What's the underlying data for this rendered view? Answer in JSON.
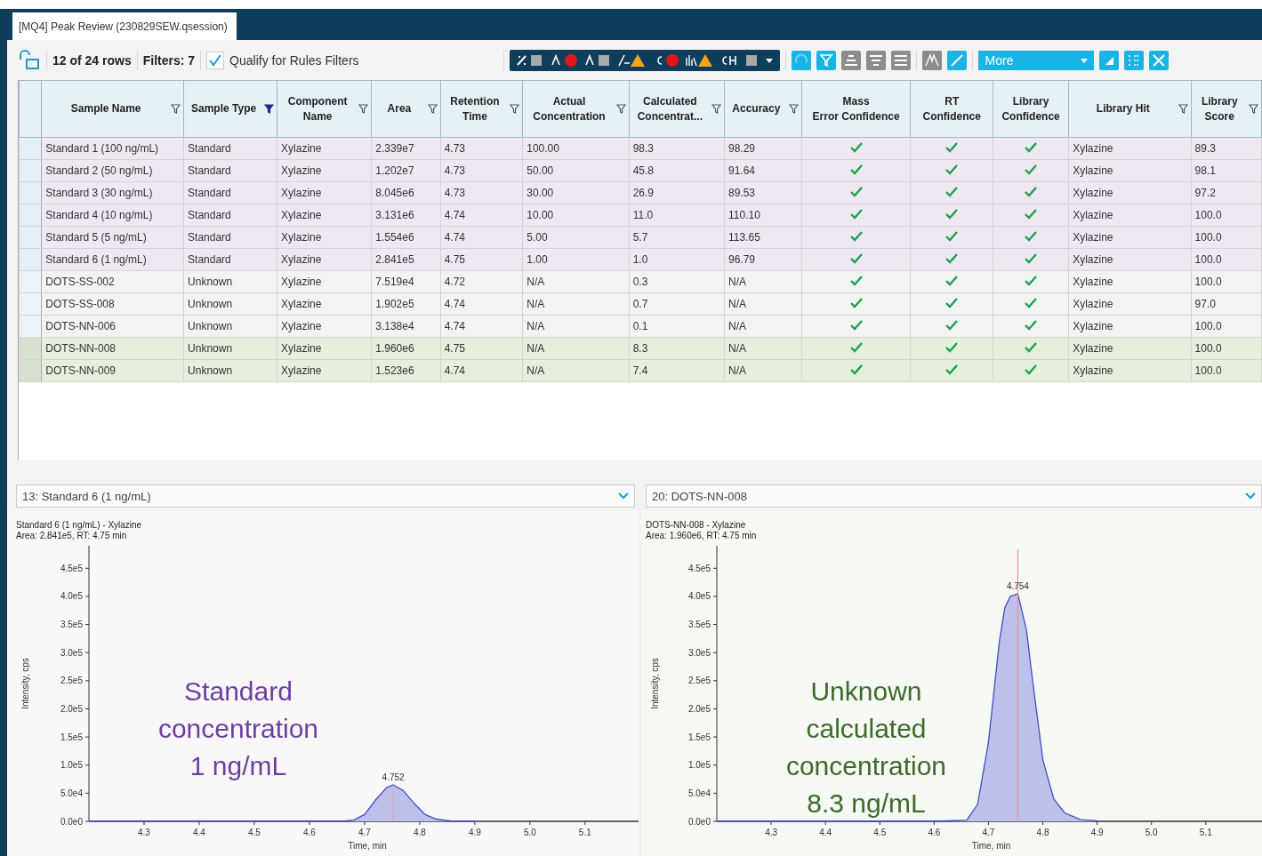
{
  "window": {
    "tab": "[MQ4] Peak Review (230829SEW.qsession)"
  },
  "toolbar": {
    "row_count": "12 of 24 rows",
    "filters": "Filters: 7",
    "qualify": {
      "label": "Qualify for Rules Filters",
      "checked": true
    },
    "more": "More"
  },
  "table": {
    "columns": [
      {
        "label": "Sample Name",
        "filterable": true,
        "filter_active": false
      },
      {
        "label": "Sample Type",
        "filterable": true,
        "filter_active": true
      },
      {
        "label": "Component\nName",
        "filterable": true,
        "filter_active": false
      },
      {
        "label": "Area",
        "filterable": true,
        "filter_active": false
      },
      {
        "label": "Retention\nTime",
        "filterable": true,
        "filter_active": false
      },
      {
        "label": "Actual\nConcentration",
        "filterable": true,
        "filter_active": false
      },
      {
        "label": "Calculated\nConcentrat...",
        "filterable": true,
        "filter_active": false
      },
      {
        "label": "Accuracy",
        "filterable": true,
        "filter_active": false
      },
      {
        "label": "Mass\nError Confidence",
        "filterable": false
      },
      {
        "label": "RT\nConfidence",
        "filterable": false
      },
      {
        "label": "Library\nConfidence",
        "filterable": false
      },
      {
        "label": "Library Hit",
        "filterable": true,
        "filter_active": false
      },
      {
        "label": "Library\nScore",
        "filterable": true,
        "filter_active": false
      }
    ],
    "rows": [
      {
        "kind": "standard",
        "selected": false,
        "cells": [
          "Standard 1 (100 ng/mL)",
          "Standard",
          "Xylazine",
          "2.339e7",
          "4.73",
          "100.00",
          "98.3",
          "98.29",
          true,
          true,
          true,
          "Xylazine",
          "89.3"
        ]
      },
      {
        "kind": "standard",
        "selected": false,
        "cells": [
          "Standard 2 (50 ng/mL)",
          "Standard",
          "Xylazine",
          "1.202e7",
          "4.73",
          "50.00",
          "45.8",
          "91.64",
          true,
          true,
          true,
          "Xylazine",
          "98.1"
        ]
      },
      {
        "kind": "standard",
        "selected": false,
        "cells": [
          "Standard 3 (30 ng/mL)",
          "Standard",
          "Xylazine",
          "8.045e6",
          "4.73",
          "30.00",
          "26.9",
          "89.53",
          true,
          true,
          true,
          "Xylazine",
          "97.2"
        ]
      },
      {
        "kind": "standard",
        "selected": false,
        "cells": [
          "Standard 4 (10 ng/mL)",
          "Standard",
          "Xylazine",
          "3.131e6",
          "4.74",
          "10.00",
          "11.0",
          "110.10",
          true,
          true,
          true,
          "Xylazine",
          "100.0"
        ]
      },
      {
        "kind": "standard",
        "selected": false,
        "cells": [
          "Standard 5 (5 ng/mL)",
          "Standard",
          "Xylazine",
          "1.554e6",
          "4.74",
          "5.00",
          "5.7",
          "113.65",
          true,
          true,
          true,
          "Xylazine",
          "100.0"
        ]
      },
      {
        "kind": "standard",
        "selected": false,
        "cells": [
          "Standard 6 (1 ng/mL)",
          "Standard",
          "Xylazine",
          "2.841e5",
          "4.75",
          "1.00",
          "1.0",
          "96.79",
          true,
          true,
          true,
          "Xylazine",
          "100.0"
        ]
      },
      {
        "kind": "unknown",
        "selected": false,
        "cells": [
          "DOTS-SS-002",
          "Unknown",
          "Xylazine",
          "7.519e4",
          "4.72",
          "N/A",
          "0.3",
          "N/A",
          true,
          true,
          true,
          "Xylazine",
          "100.0"
        ]
      },
      {
        "kind": "unknown",
        "selected": false,
        "cells": [
          "DOTS-SS-008",
          "Unknown",
          "Xylazine",
          "1.902e5",
          "4.74",
          "N/A",
          "0.7",
          "N/A",
          true,
          true,
          true,
          "Xylazine",
          "97.0"
        ]
      },
      {
        "kind": "unknown",
        "selected": false,
        "cells": [
          "DOTS-NN-006",
          "Unknown",
          "Xylazine",
          "3.138e4",
          "4.74",
          "N/A",
          "0.1",
          "N/A",
          true,
          true,
          true,
          "Xylazine",
          "100.0"
        ]
      },
      {
        "kind": "unknown",
        "selected": true,
        "cells": [
          "DOTS-NN-008",
          "Unknown",
          "Xylazine",
          "1.960e6",
          "4.75",
          "N/A",
          "8.3",
          "N/A",
          true,
          true,
          true,
          "Xylazine",
          "100.0"
        ]
      },
      {
        "kind": "unknown",
        "selected": true,
        "cells": [
          "DOTS-NN-009",
          "Unknown",
          "Xylazine",
          "1.523e6",
          "4.74",
          "N/A",
          "7.4",
          "N/A",
          true,
          true,
          true,
          "Xylazine",
          "100.0"
        ]
      }
    ]
  },
  "panels": [
    {
      "kind": "standard",
      "selector": "13: Standard 6 (1 ng/mL)",
      "title": "Standard 6 (1 ng/mL) - Xylazine",
      "subtitle": "Area: 2.841e5, RT: 4.75 min",
      "note_lines": [
        "Standard",
        "concentration",
        "1 ng/mL"
      ],
      "chart_data": {
        "type": "area",
        "xlabel": "Time, min",
        "ylabel": "Intensity, cps",
        "x": [
          4.2,
          4.6,
          4.66,
          4.68,
          4.7,
          4.72,
          4.74,
          4.752,
          4.77,
          4.79,
          4.81,
          4.83,
          4.86,
          4.9
        ],
        "series": [
          {
            "color": "#3f4fc0",
            "values": [
              0,
              0,
              0,
              2000,
              12000,
              38000,
              60000,
              65000,
              55000,
              32000,
              12000,
              4000,
              0,
              0
            ]
          }
        ],
        "xlim": [
          4.2,
          5.21
        ],
        "ylim": [
          0,
          490000
        ],
        "xticks": [
          4.3,
          4.4,
          4.5,
          4.6,
          4.7,
          4.8,
          4.9,
          {
            "value": 5,
            "label": "5.0"
          },
          5.1
        ],
        "yticks": [
          {
            "value": 0,
            "label": "0.0e0"
          },
          {
            "value": 50000,
            "label": "5.0e4"
          },
          {
            "value": 100000,
            "label": "1.0e5"
          },
          {
            "value": 150000,
            "label": "1.5e5"
          },
          {
            "value": 200000,
            "label": "2.0e5"
          },
          {
            "value": 250000,
            "label": "2.5e5"
          },
          {
            "value": 300000,
            "label": "3.0e5"
          },
          {
            "value": 350000,
            "label": "3.5e5"
          },
          {
            "value": 400000,
            "label": "4.0e5"
          },
          {
            "value": 450000,
            "label": "4.5e5"
          }
        ],
        "annotations": [
          {
            "x": 4.752,
            "y": 65000,
            "text": "4.752"
          }
        ],
        "ref_lines": [
          {
            "axis": "x",
            "value": 4.752
          }
        ]
      }
    },
    {
      "kind": "unknown",
      "selector": "20: DOTS-NN-008",
      "title": "DOTS-NN-008 - Xylazine",
      "subtitle": "Area: 1.960e6, RT: 4.75 min",
      "note_lines": [
        "Unknown",
        "calculated",
        "concentration",
        "8.3 ng/mL"
      ],
      "chart_data": {
        "type": "area",
        "xlabel": "Time, min",
        "ylabel": "Intensity, cps",
        "x": [
          4.2,
          4.6,
          4.66,
          4.68,
          4.7,
          4.72,
          4.73,
          4.74,
          4.754,
          4.77,
          4.78,
          4.8,
          4.82,
          4.84,
          4.87,
          4.9
        ],
        "series": [
          {
            "color": "#3f4fc0",
            "values": [
              0,
              0,
              2000,
              30000,
              140000,
              320000,
              380000,
              400000,
              405000,
              340000,
              260000,
              110000,
              40000,
              15000,
              3000,
              1000
            ]
          }
        ],
        "xlim": [
          4.2,
          5.21
        ],
        "ylim": [
          0,
          490000
        ],
        "xticks": [
          4.3,
          4.4,
          4.5,
          4.6,
          4.7,
          4.8,
          4.9,
          {
            "value": 5,
            "label": "5.0"
          },
          5.1
        ],
        "yticks": [
          {
            "value": 0,
            "label": "0.0e0"
          },
          {
            "value": 50000,
            "label": "5.0e4"
          },
          {
            "value": 100000,
            "label": "1.0e5"
          },
          {
            "value": 150000,
            "label": "1.5e5"
          },
          {
            "value": 200000,
            "label": "2.0e5"
          },
          {
            "value": 250000,
            "label": "2.5e5"
          },
          {
            "value": 300000,
            "label": "3.0e5"
          },
          {
            "value": 350000,
            "label": "3.5e5"
          },
          {
            "value": 400000,
            "label": "4.0e5"
          },
          {
            "value": 450000,
            "label": "4.5e5"
          }
        ],
        "annotations": [
          {
            "x": 4.754,
            "y": 405000,
            "text": "4.754"
          }
        ],
        "ref_lines": [
          {
            "axis": "x",
            "value": 4.754
          }
        ]
      }
    }
  ]
}
